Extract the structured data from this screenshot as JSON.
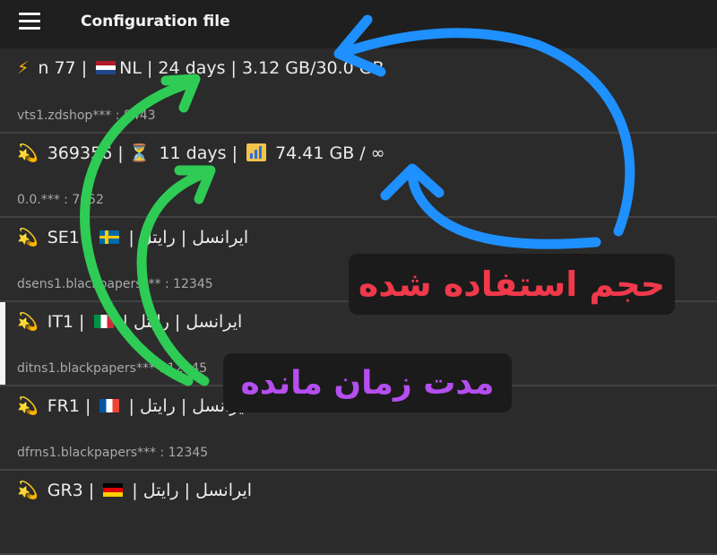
{
  "header": {
    "title": "Configuration file",
    "menu_icon": "hamburger-menu-icon"
  },
  "configs": [
    {
      "line1_a": "n        77 |",
      "flag": "nl",
      "line1_b": "NL | 24 days | 3.12 GB/30.0 GB",
      "line2": "vts1.zdshop*** : 8443",
      "icon": "lightning-icon",
      "icon_glyph": "⚡"
    },
    {
      "line1_a": "369356                 |",
      "hourglass": "⏳",
      "days": "11 days |",
      "data": "74.41 GB / ∞",
      "line2": "0.0.*** : 7052",
      "icon": "dizzy-star-icon",
      "icon_glyph": "💫"
    },
    {
      "line1_a": "SE1 |",
      "flag": "se",
      "line1_b": "| ایرانسل | رایتل",
      "line2": "dsens1.blackpapers*** : 12345",
      "icon": "dizzy-star-icon",
      "icon_glyph": "💫"
    },
    {
      "line1_a": "IT1 |",
      "flag": "it",
      "line1_b": "| ایرانسل | رایتل",
      "line2": "ditns1.blackpapers*** : 12345",
      "icon": "dizzy-star-icon",
      "icon_glyph": "💫",
      "selected": true
    },
    {
      "line1_a": "FR1 |",
      "flag": "fr",
      "line1_b": "| ایرانسل | رایتل",
      "line2": "dfrns1.blackpapers*** : 12345",
      "icon": "dizzy-star-icon",
      "icon_glyph": "💫"
    },
    {
      "line1_a": "GR3 |",
      "flag": "de",
      "line1_b": "| ایرانسل | رایتل",
      "line2": "",
      "icon": "dizzy-star-icon",
      "icon_glyph": "💫"
    }
  ],
  "annotations": {
    "used_volume": "حجم استفاده شده",
    "remaining_time": "مدت زمان مانده",
    "colors": {
      "used_volume": "#f0394b",
      "remaining_time": "#b54ef0",
      "blue_arrow": "#1e90ff",
      "green_arrow": "#2ecc55"
    }
  }
}
